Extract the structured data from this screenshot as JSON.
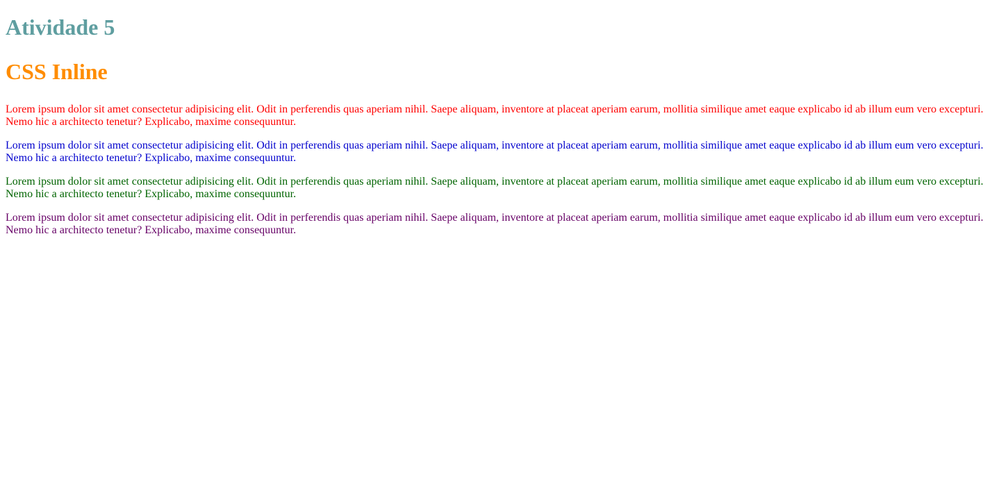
{
  "headings": {
    "title": "Atividade 5",
    "subtitle": "CSS Inline"
  },
  "colors": {
    "title": "#5f9ea0",
    "subtitle": "#ff8c00",
    "paragraph_1": "#ff0000",
    "paragraph_2": "#0000cd",
    "paragraph_3": "#006400",
    "paragraph_4": "#660066"
  },
  "paragraphs": [
    "Lorem ipsum dolor sit amet consectetur adipisicing elit. Odit in perferendis quas aperiam nihil. Saepe aliquam, inventore at placeat aperiam earum, mollitia similique amet eaque explicabo id ab illum eum vero excepturi. Nemo hic a architecto tenetur? Explicabo, maxime consequuntur.",
    "Lorem ipsum dolor sit amet consectetur adipisicing elit. Odit in perferendis quas aperiam nihil. Saepe aliquam, inventore at placeat aperiam earum, mollitia similique amet eaque explicabo id ab illum eum vero excepturi. Nemo hic a architecto tenetur? Explicabo, maxime consequuntur.",
    "Lorem ipsum dolor sit amet consectetur adipisicing elit. Odit in perferendis quas aperiam nihil. Saepe aliquam, inventore at placeat aperiam earum, mollitia similique amet eaque explicabo id ab illum eum vero excepturi. Nemo hic a architecto tenetur? Explicabo, maxime consequuntur.",
    "Lorem ipsum dolor sit amet consectetur adipisicing elit. Odit in perferendis quas aperiam nihil. Saepe aliquam, inventore at placeat aperiam earum, mollitia similique amet eaque explicabo id ab illum eum vero excepturi. Nemo hic a architecto tenetur? Explicabo, maxime consequuntur."
  ]
}
